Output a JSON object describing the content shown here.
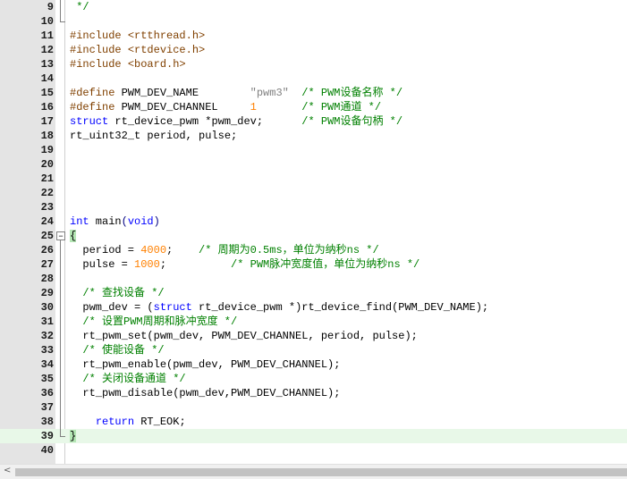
{
  "editor": {
    "current_line": 39,
    "lines": [
      {
        "n": "9",
        "tokens": [
          {
            "t": " */",
            "c": "cm"
          }
        ]
      },
      {
        "n": "10",
        "tokens": []
      },
      {
        "n": "11",
        "tokens": [
          {
            "t": "#include ",
            "c": "pp"
          },
          {
            "t": "<rtthread.h>",
            "c": "str2"
          }
        ]
      },
      {
        "n": "12",
        "tokens": [
          {
            "t": "#include ",
            "c": "pp"
          },
          {
            "t": "<rtdevice.h>",
            "c": "str2"
          }
        ]
      },
      {
        "n": "13",
        "tokens": [
          {
            "t": "#include ",
            "c": "pp"
          },
          {
            "t": "<board.h>",
            "c": "str2"
          }
        ]
      },
      {
        "n": "14",
        "tokens": []
      },
      {
        "n": "15",
        "tokens": [
          {
            "t": "#define ",
            "c": "pp"
          },
          {
            "t": "PWM_DEV_NAME        ",
            "c": "plain"
          },
          {
            "t": "\"pwm3\"",
            "c": "strq"
          },
          {
            "t": "  /* PWM设备名称 */",
            "c": "cm"
          }
        ]
      },
      {
        "n": "16",
        "tokens": [
          {
            "t": "#define ",
            "c": "pp"
          },
          {
            "t": "PWM_DEV_CHANNEL     ",
            "c": "plain"
          },
          {
            "t": "1",
            "c": "num"
          },
          {
            "t": "       /* PWM通道 */",
            "c": "cm"
          }
        ]
      },
      {
        "n": "17",
        "tokens": [
          {
            "t": "struct",
            "c": "kw"
          },
          {
            "t": " rt_device_pwm *pwm_dev;      ",
            "c": "plain"
          },
          {
            "t": "/* PWM设备句柄 */",
            "c": "cm"
          }
        ]
      },
      {
        "n": "18",
        "tokens": [
          {
            "t": "rt_uint32_t period, pulse;",
            "c": "plain"
          }
        ]
      },
      {
        "n": "19",
        "tokens": []
      },
      {
        "n": "20",
        "tokens": []
      },
      {
        "n": "21",
        "tokens": []
      },
      {
        "n": "22",
        "tokens": []
      },
      {
        "n": "23",
        "tokens": []
      },
      {
        "n": "24",
        "tokens": [
          {
            "t": "int",
            "c": "kw"
          },
          {
            "t": " main",
            "c": "plain"
          },
          {
            "t": "(",
            "c": "op"
          },
          {
            "t": "void",
            "c": "kw"
          },
          {
            "t": ")",
            "c": "op"
          }
        ]
      },
      {
        "n": "25",
        "tokens": [
          {
            "t": "{",
            "c": "bracket"
          }
        ]
      },
      {
        "n": "26",
        "tokens": [
          {
            "t": "  period = ",
            "c": "plain"
          },
          {
            "t": "4000",
            "c": "num"
          },
          {
            "t": ";    ",
            "c": "plain"
          },
          {
            "t": "/* 周期为0.5ms，单位为纳秒ns */",
            "c": "cm"
          }
        ]
      },
      {
        "n": "27",
        "tokens": [
          {
            "t": "  pulse = ",
            "c": "plain"
          },
          {
            "t": "1000",
            "c": "num"
          },
          {
            "t": ";          ",
            "c": "plain"
          },
          {
            "t": "/* PWM脉冲宽度值，单位为纳秒ns */",
            "c": "cm"
          }
        ]
      },
      {
        "n": "28",
        "tokens": []
      },
      {
        "n": "29",
        "tokens": [
          {
            "t": "  /* 查找设备 */",
            "c": "cm"
          }
        ]
      },
      {
        "n": "30",
        "tokens": [
          {
            "t": "  pwm_dev = (",
            "c": "plain"
          },
          {
            "t": "struct",
            "c": "kw"
          },
          {
            "t": " rt_device_pwm *)rt_device_find(PWM_DEV_NAME);",
            "c": "plain"
          }
        ]
      },
      {
        "n": "31",
        "tokens": [
          {
            "t": "  /* 设置PWM周期和脉冲宽度 */",
            "c": "cm"
          }
        ]
      },
      {
        "n": "32",
        "tokens": [
          {
            "t": "  rt_pwm_set(pwm_dev, PWM_DEV_CHANNEL, period, pulse);",
            "c": "plain"
          }
        ]
      },
      {
        "n": "33",
        "tokens": [
          {
            "t": "  /* 使能设备 */",
            "c": "cm"
          }
        ]
      },
      {
        "n": "34",
        "tokens": [
          {
            "t": "  rt_pwm_enable(pwm_dev, PWM_DEV_CHANNEL);",
            "c": "plain"
          }
        ]
      },
      {
        "n": "35",
        "tokens": [
          {
            "t": "  /* 关闭设备通道 */",
            "c": "cm"
          }
        ]
      },
      {
        "n": "36",
        "tokens": [
          {
            "t": "  rt_pwm_disable(pwm_dev,PWM_DEV_CHANNEL);",
            "c": "plain"
          }
        ]
      },
      {
        "n": "37",
        "tokens": []
      },
      {
        "n": "38",
        "tokens": [
          {
            "t": "    ",
            "c": "plain"
          },
          {
            "t": "return",
            "c": "kw"
          },
          {
            "t": " RT_EOK;",
            "c": "plain"
          }
        ]
      },
      {
        "n": "39",
        "tokens": [
          {
            "t": "}",
            "c": "bracket"
          }
        ]
      },
      {
        "n": "40",
        "tokens": []
      }
    ]
  },
  "scrollbar": {
    "left_arrow_icon": "chevron-left-icon",
    "left_arrow": "<"
  },
  "colors": {
    "keyword": "#0000ff",
    "preprocessor": "#804000",
    "comment": "#008000",
    "number": "#ff8000",
    "string": "#808080",
    "current_line": "#e8f8e8"
  }
}
